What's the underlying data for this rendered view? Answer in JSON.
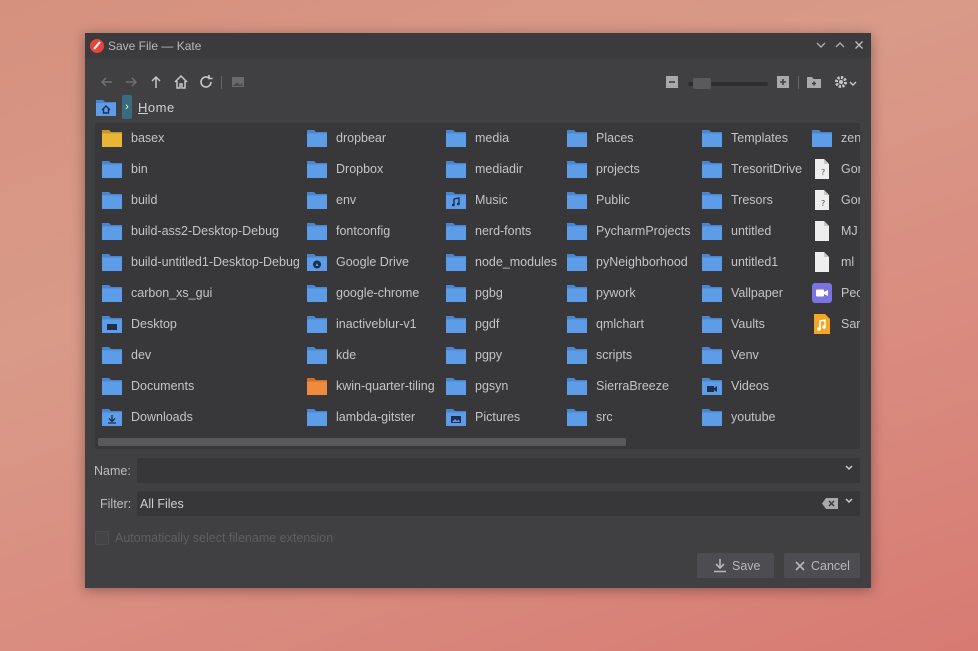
{
  "window": {
    "title": "Save File — Kate"
  },
  "breadcrumb": {
    "current": "Home"
  },
  "files": {
    "columns": [
      [
        {
          "name": "basex",
          "icon": "folder-yellow"
        },
        {
          "name": "bin",
          "icon": "folder"
        },
        {
          "name": "build",
          "icon": "folder"
        },
        {
          "name": "build-ass2-Desktop-Debug",
          "icon": "folder"
        },
        {
          "name": "build-untitled1-Desktop-Debug",
          "icon": "folder"
        },
        {
          "name": "carbon_xs_gui",
          "icon": "folder"
        },
        {
          "name": "Desktop",
          "icon": "folder-desktop"
        },
        {
          "name": "dev",
          "icon": "folder"
        },
        {
          "name": "Documents",
          "icon": "folder"
        },
        {
          "name": "Downloads",
          "icon": "folder-downloads"
        }
      ],
      [
        {
          "name": "dropbear",
          "icon": "folder"
        },
        {
          "name": "Dropbox",
          "icon": "folder"
        },
        {
          "name": "env",
          "icon": "folder"
        },
        {
          "name": "fontconfig",
          "icon": "folder"
        },
        {
          "name": "Google Drive",
          "icon": "folder-google-drive"
        },
        {
          "name": "google-chrome",
          "icon": "folder"
        },
        {
          "name": "inactiveblur-v1",
          "icon": "folder"
        },
        {
          "name": "kde",
          "icon": "folder"
        },
        {
          "name": "kwin-quarter-tiling",
          "icon": "folder-orange"
        },
        {
          "name": "lambda-gitster",
          "icon": "folder"
        }
      ],
      [
        {
          "name": "media",
          "icon": "folder"
        },
        {
          "name": "mediadir",
          "icon": "folder"
        },
        {
          "name": "Music",
          "icon": "folder-music"
        },
        {
          "name": "nerd-fonts",
          "icon": "folder"
        },
        {
          "name": "node_modules",
          "icon": "folder"
        },
        {
          "name": "pgbg",
          "icon": "folder"
        },
        {
          "name": "pgdf",
          "icon": "folder"
        },
        {
          "name": "pgpy",
          "icon": "folder"
        },
        {
          "name": "pgsyn",
          "icon": "folder"
        },
        {
          "name": "Pictures",
          "icon": "folder-pictures"
        }
      ],
      [
        {
          "name": "Places",
          "icon": "folder"
        },
        {
          "name": "projects",
          "icon": "folder"
        },
        {
          "name": "Public",
          "icon": "folder"
        },
        {
          "name": "PycharmProjects",
          "icon": "folder"
        },
        {
          "name": "pyNeighborhood",
          "icon": "folder"
        },
        {
          "name": "pywork",
          "icon": "folder"
        },
        {
          "name": "qmlchart",
          "icon": "folder"
        },
        {
          "name": "scripts",
          "icon": "folder"
        },
        {
          "name": "SierraBreeze",
          "icon": "folder"
        },
        {
          "name": "src",
          "icon": "folder"
        }
      ],
      [
        {
          "name": "Templates",
          "icon": "folder"
        },
        {
          "name": "TresoritDrive",
          "icon": "folder"
        },
        {
          "name": "Tresors",
          "icon": "folder"
        },
        {
          "name": "untitled",
          "icon": "folder"
        },
        {
          "name": "untitled1",
          "icon": "folder"
        },
        {
          "name": "Vallpaper",
          "icon": "folder"
        },
        {
          "name": "Vaults",
          "icon": "folder"
        },
        {
          "name": "Venv",
          "icon": "folder"
        },
        {
          "name": "Videos",
          "icon": "folder-videos"
        },
        {
          "name": "youtube",
          "icon": "folder"
        }
      ],
      [
        {
          "name": "zen",
          "icon": "folder"
        },
        {
          "name": "Gor",
          "icon": "file-unknown"
        },
        {
          "name": "Gor",
          "icon": "file-unknown"
        },
        {
          "name": "MJ",
          "icon": "file"
        },
        {
          "name": "ml",
          "icon": "file"
        },
        {
          "name": "Pec",
          "icon": "file-video"
        },
        {
          "name": "Sar",
          "icon": "file-audio"
        }
      ]
    ]
  },
  "name_field": {
    "label": "Name:",
    "value": ""
  },
  "filter_field": {
    "label": "Filter:",
    "value": "All Files"
  },
  "auto_extension": {
    "label": "Automatically select filename extension",
    "checked": false
  },
  "buttons": {
    "save": "Save",
    "cancel": "Cancel"
  },
  "colors": {
    "folder": "#5d9de8",
    "folder_dark": "#4a86d0",
    "folder_yellow": "#e8b534",
    "folder_orange": "#f08a3c"
  }
}
